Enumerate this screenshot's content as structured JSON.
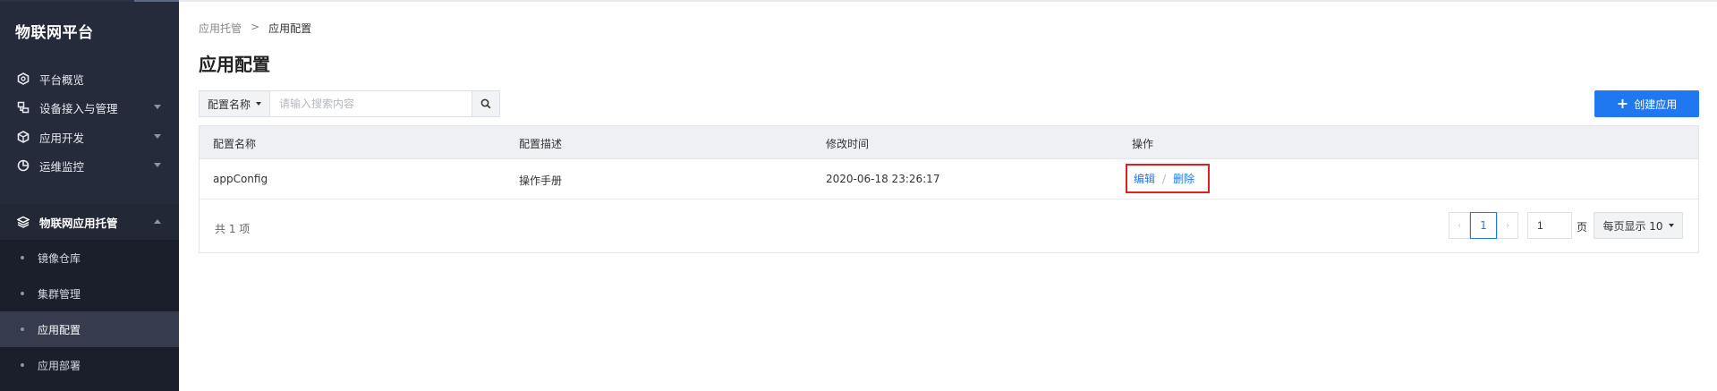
{
  "sidebar": {
    "brand": "物联网平台",
    "items": [
      {
        "label": "平台概览",
        "icon": "platform-overview-icon"
      },
      {
        "label": "设备接入与管理",
        "icon": "device-management-icon"
      },
      {
        "label": "应用开发",
        "icon": "app-development-icon"
      },
      {
        "label": "运维监控",
        "icon": "monitoring-icon"
      },
      {
        "label": "物联网应用托管",
        "icon": "app-hosting-icon"
      }
    ],
    "sub_items": [
      {
        "label": "镜像仓库"
      },
      {
        "label": "集群管理"
      },
      {
        "label": "应用配置"
      },
      {
        "label": "应用部署"
      }
    ],
    "active_sub_item": "应用配置",
    "colors": {
      "background": "#252b3a",
      "active": "#363c4d"
    }
  },
  "breadcrumb": {
    "parent": "应用托管",
    "separator": ">",
    "current": "应用配置"
  },
  "page_title": "应用配置",
  "search": {
    "field_select": "配置名称",
    "placeholder": "请输入搜索内容",
    "value": ""
  },
  "create_button": {
    "label": "创建应用",
    "color": "#1f78f0"
  },
  "table": {
    "headers": {
      "name": "配置名称",
      "description": "配置描述",
      "modified": "修改时间",
      "actions": "操作"
    },
    "rows": [
      {
        "name": "appConfig",
        "description": "操作手册",
        "modified": "2020-06-18 23:26:17",
        "edit_label": "编辑",
        "action_separator": "/",
        "delete_label": "删除"
      }
    ]
  },
  "pagination": {
    "total_text": "共 1 项",
    "current_page": "1",
    "jump_value": "1",
    "page_unit": "页",
    "page_size_label": "每页显示 10"
  },
  "highlight_color": "#e02020"
}
